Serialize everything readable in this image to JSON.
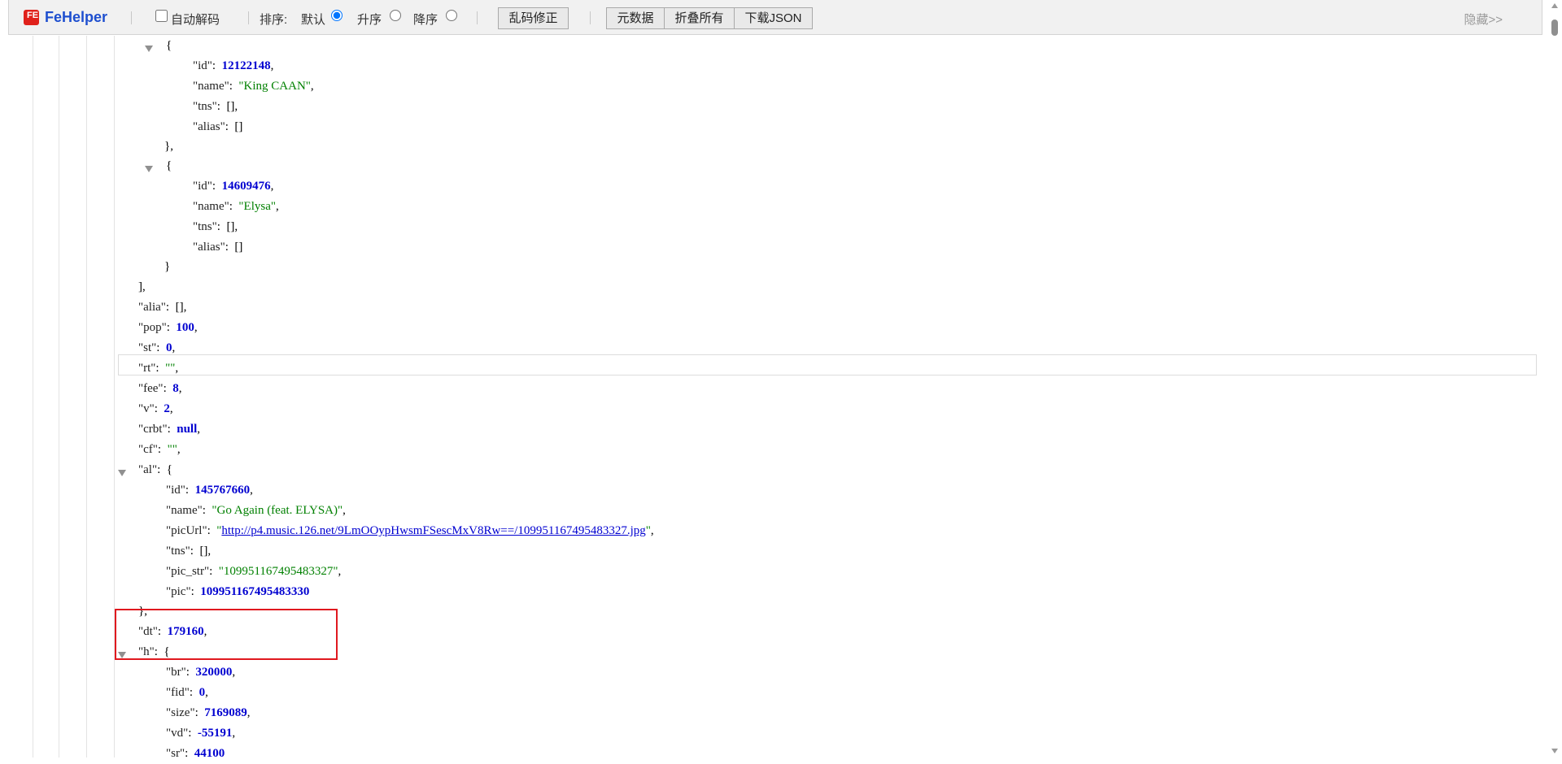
{
  "toolbar": {
    "brand": "FeHelper",
    "logo_text": "FE",
    "auto_decode_label": "自动解码",
    "sort_label": "排序:",
    "sort_default": "默认",
    "sort_asc": "升序",
    "sort_desc": "降序",
    "fix_encoding_button": "乱码修正",
    "metadata_button": "元数据",
    "collapse_all_button": "折叠所有",
    "download_json_button": "下载JSON",
    "hide_link": "隐藏>>"
  },
  "json": {
    "a1_id_key": "\"id\"",
    "a1_id_val": "12122148",
    "a1_name_key": "\"name\"",
    "a1_name_val": "\"King CAAN\"",
    "a1_tns_key": "\"tns\"",
    "a1_alias_key": "\"alias\"",
    "a2_id_key": "\"id\"",
    "a2_id_val": "14609476",
    "a2_name_key": "\"name\"",
    "a2_name_val": "\"Elysa\"",
    "a2_tns_key": "\"tns\"",
    "a2_alias_key": "\"alias\"",
    "alia_key": "\"alia\"",
    "pop_key": "\"pop\"",
    "pop_val": "100",
    "st_key": "\"st\"",
    "st_val": "0",
    "rt_key": "\"rt\"",
    "rt_val": "\"\"",
    "fee_key": "\"fee\"",
    "fee_val": "8",
    "v_key": "\"v\"",
    "v_val": "2",
    "crbt_key": "\"crbt\"",
    "crbt_val": "null",
    "cf_key": "\"cf\"",
    "cf_val": "\"\"",
    "al_key": "\"al\"",
    "al_id_key": "\"id\"",
    "al_id_val": "145767660",
    "al_name_key": "\"name\"",
    "al_name_val": "\"Go Again (feat. ELYSA)\"",
    "al_picurl_key": "\"picUrl\"",
    "al_picurl_q": "\"",
    "al_picurl_val": "http://p4.music.126.net/9LmOOypHwsmFSescMxV8Rw==/109951167495483327.jpg",
    "al_tns_key": "\"tns\"",
    "al_picstr_key": "\"pic_str\"",
    "al_picstr_val": "\"109951167495483327\"",
    "al_pic_key": "\"pic\"",
    "al_pic_val": "109951167495483330",
    "dt_key": "\"dt\"",
    "dt_val": "179160",
    "h_key": "\"h\"",
    "h_br_key": "\"br\"",
    "h_br_val": "320000",
    "h_fid_key": "\"fid\"",
    "h_fid_val": "0",
    "h_size_key": "\"size\"",
    "h_size_val": "7169089",
    "h_vd_key": "\"vd\"",
    "h_vd_val": "-55191",
    "h_sr_key": "\"sr\"",
    "h_sr_val": "44100"
  },
  "punct": {
    "colon": ":",
    "comma": ",",
    "open_brace": "{",
    "close_brace": "}",
    "close_brace_comma": "},",
    "close_bracket_comma": "],",
    "empty_array": "[]",
    "empty_array_comma": "[],"
  },
  "colors": {
    "brand": "#1e4fcf",
    "number": "#0000d0",
    "string": "#008000",
    "highlight_box": "#e0191f"
  }
}
